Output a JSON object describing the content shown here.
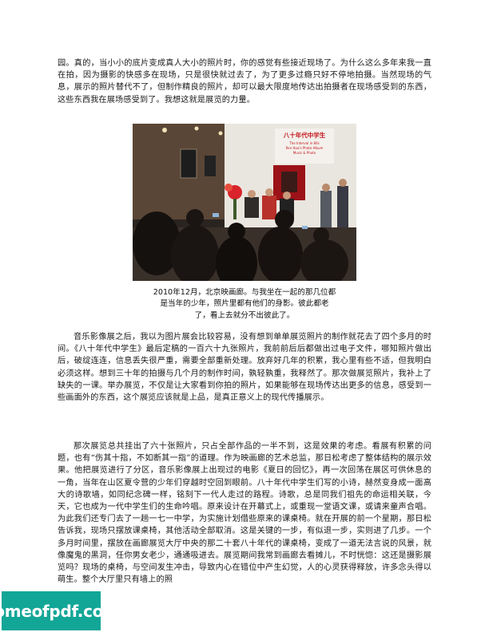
{
  "paragraphs": {
    "p1": "园。真的，当小小的底片变成真人大小的照片时，你的感觉有些接近现场了。为什么这么多年来我一直在拍，因为摄影的快感多在现场，只是很快就过去了，为了更多过瘾只好不停地拍摄。当然现场的气息，展示的照片替代不了，但制作精良的照片，却可以最大限度地传达出拍摄者在现场感受到的东西，这些东西我在展场感受到了。我想这就是展览的力量。",
    "p2": "音乐影像展之后，我以为图片展会比较容易，没有想到单单展览照片的制作就花去了四个多月的时间。《八十年代中学生》最后定稿的一百六十九张照片，我前前后后都做出过电子文件，哪知照片做出后，破绽连连，信息丢失很严重，需要全部重新处理。放弃好几年的积累，我心里有些不适，但我明白必须这样。想到三十年的拍摄与几个月的制作时间，孰轻孰重，我释然了。那次做展览照片，我补上了缺失的一课。举办展览，不仅是让大家看到你拍的照片，如果能够在现场传达出更多的信息，感受到一些画面外的东西，这个展览应该就是上品，是真正意义上的现代传播展示。",
    "p3": "那次展览总共挂出了六十张照片，只占全部作品的一半不到，这是效果的考虑。看展有积累的问题，也有“伤其十指，不如断其一指”的道理。作为映画廊的艺术总监，那日松考虑了整体结构的展示效果。他把展览进行了分区，音乐影像展上出现过的电影《夏日的回忆》，再一次回荡在展区可供休息的一角，当年在山区夏令营的少年们穿越时空回到眼前。八十年代中学生们写的小诗，赫然变身成一面高大的诗歌墙，如同纪念碑一样，铭刻下一代人走过的路程。诗歌，总是同我们祖先的命运相关联，今天，它也成为一代中学生们的生命吟唱。原来设计在开幕式上，或重现一堂语文课，或请来童声合唱。为此我们还专门去了一趟一七一中学，为实施计划借些原来的课桌椅。就在开展的前一个星期，那日松告诉我，现场只摆放课桌椅，其他活动全部取消。这是关键的一步，有似退一步，实则进了几步。一个多月时间里，摆放在画廊展览大厅中央的那二十套八十年代的课桌椅，变成了一道无法言说的风景，就像魔鬼的黑洞，任你男女老少，通通吸进去。展览期间我常到画廊去看摊儿，不时恍惚：这还是摄影展览吗？现场的桌椅，与空间发生冲击，导致内心在错位中产生幻觉，人的心灵获得释放，许多念头得以萌生。整个大厅里只有墙上的照"
  },
  "photo": {
    "banner_title": "八十年代中学生",
    "banner_line2": "The Interval in 80s",
    "banner_line3": "Ren Hua's Photo Album",
    "banner_line4": "Music & Photo",
    "colors": {
      "wall": "#e9e6df",
      "ceiling": "#1c1714",
      "banner_red": "#c4161c",
      "flowers": "#d8242a",
      "crowd": "#15110f"
    }
  },
  "caption": {
    "line1": "2010年12月，北京映画廊。与我坐在一起的那几位都",
    "line2": "是当年的少年，照片里都有他们的身影。彼此都老",
    "line3": "了，看上去就分不出彼此了。"
  },
  "watermark": {
    "text": "homeofpdf.com",
    "color": "#12a697"
  }
}
